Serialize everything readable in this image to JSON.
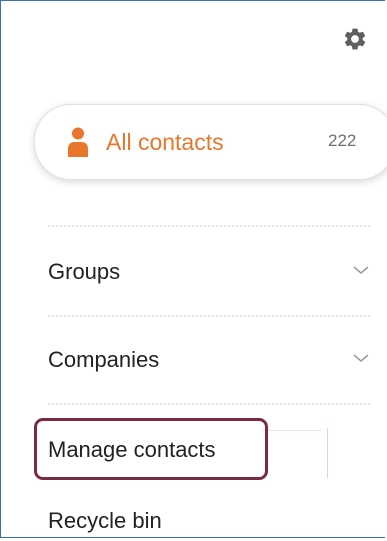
{
  "header": {
    "settings_icon": "gear-icon"
  },
  "all_contacts": {
    "icon": "person-icon",
    "label": "All contacts",
    "count": "222",
    "accent_color": "#e8762c"
  },
  "menu": {
    "groups": {
      "label": "Groups",
      "icon": "chevron-down-icon"
    },
    "companies": {
      "label": "Companies",
      "icon": "chevron-down-icon"
    },
    "manage_contacts": {
      "label": "Manage contacts",
      "highlight_color": "#7a2a45"
    },
    "recycle_bin": {
      "label": "Recycle bin"
    }
  }
}
